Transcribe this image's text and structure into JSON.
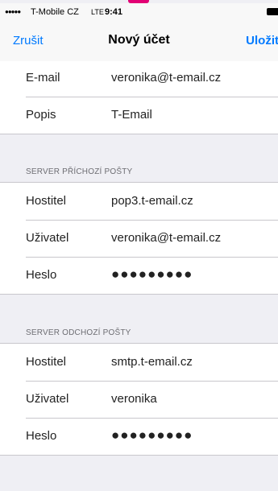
{
  "status_bar": {
    "signal": "●●●●●",
    "carrier": "T-Mobile CZ",
    "network": "LTE",
    "time": "9:41"
  },
  "nav": {
    "cancel_label": "Zrušit",
    "title": "Nový účet",
    "save_label": "Uložit"
  },
  "account": {
    "email_label": "E-mail",
    "email_value": "veronika@t-email.cz",
    "description_label": "Popis",
    "description_value": "T-Email"
  },
  "incoming": {
    "header": "SERVER PŘÍCHOZÍ POŠTY",
    "host_label": "Hostitel",
    "host_value": "pop3.t-email.cz",
    "user_label": "Uživatel",
    "user_value": "veronika@t-email.cz",
    "password_label": "Heslo",
    "password_value": "●●●●●●●●●"
  },
  "outgoing": {
    "header": "SERVER ODCHOZÍ POŠTY",
    "host_label": "Hostitel",
    "host_value": "smtp.t-email.cz",
    "user_label": "Uživatel",
    "user_value": "veronika",
    "password_label": "Heslo",
    "password_value": "●●●●●●●●●"
  }
}
